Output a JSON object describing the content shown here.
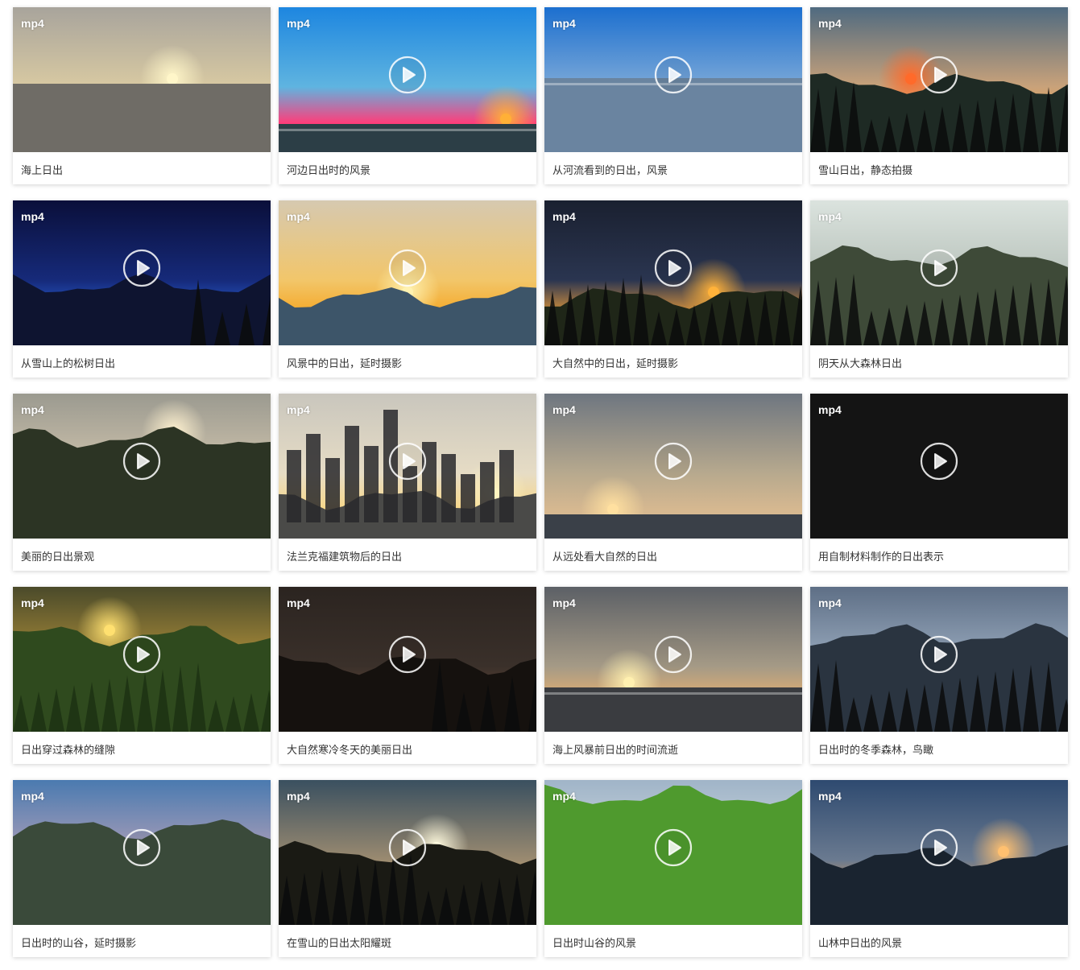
{
  "colors": {
    "card_bg": "#ffffff",
    "title_text": "#333333",
    "badge_text": "#ffffff"
  },
  "videos": [
    {
      "format": "mp4",
      "title": "海上日出",
      "scene": "sea-sunrise",
      "show_play": false,
      "sky": [
        "#a8a49c",
        "#d8c9a2",
        "#e8d6a4"
      ],
      "ground": "#6f6c66",
      "sun": "#fff6c9",
      "icon": "sun-icon"
    },
    {
      "format": "mp4",
      "title": "河边日出时的风景",
      "scene": "river-sunset",
      "show_play": true,
      "sky": [
        "#1d86e0",
        "#5fb4e0",
        "#ff3d7a"
      ],
      "ground": "#2c3e46",
      "sun": "#ffb037",
      "icon": "play-icon"
    },
    {
      "format": "mp4",
      "title": "从河流看到的日出，风景",
      "scene": "river-lake",
      "show_play": true,
      "sky": [
        "#1c6fcf",
        "#7aa8d8",
        "#ff5a8a"
      ],
      "ground": "#6a84a0",
      "sun": "#ffd6a0",
      "icon": "play-icon"
    },
    {
      "format": "mp4",
      "title": "雪山日出，静态拍摄",
      "scene": "snow-mountain",
      "show_play": true,
      "sky": [
        "#4f6a80",
        "#c9a27a",
        "#f2a64a"
      ],
      "ground": "#1e2a24",
      "sun": "#ff6a2a",
      "icon": "play-icon"
    },
    {
      "format": "mp4",
      "title": "从雪山上的松树日出",
      "scene": "pine-night",
      "show_play": true,
      "sky": [
        "#0a0f3a",
        "#162a7a",
        "#2a62d8"
      ],
      "ground": "#0e1430",
      "sun": "#2a62d8",
      "icon": "play-icon"
    },
    {
      "format": "mp4",
      "title": "风景中的日出，延时摄影",
      "scene": "landscape-timelapse",
      "show_play": true,
      "sky": [
        "#d6c9b0",
        "#f2c66a",
        "#f5a623"
      ],
      "ground": "#3d5569",
      "sun": "#fff2b0",
      "icon": "play-icon"
    },
    {
      "format": "mp4",
      "title": "大自然中的日出，延时摄影",
      "scene": "night-sunrise",
      "show_play": true,
      "sky": [
        "#1a2030",
        "#2a3550",
        "#e69a3a"
      ],
      "ground": "#1f2618",
      "sun": "#ffb23a",
      "icon": "play-icon"
    },
    {
      "format": "mp4",
      "title": "阴天从大森林日出",
      "scene": "cloudy-forest",
      "show_play": true,
      "sky": [
        "#dbe3de",
        "#b8c2bb",
        "#8a968c"
      ],
      "ground": "#3e4a38",
      "sun": "#ffffff",
      "icon": "play-icon"
    },
    {
      "format": "mp4",
      "title": "美丽的日出景观",
      "scene": "valley-misty",
      "show_play": true,
      "sky": [
        "#9b9a90",
        "#cfc3ac",
        "#e6d5b0"
      ],
      "ground": "#2c3424",
      "sun": "#fff2d0",
      "icon": "play-icon"
    },
    {
      "format": "mp4",
      "title": "法兰克福建筑物后的日出",
      "scene": "city-skyline",
      "show_play": true,
      "sky": [
        "#c9c6bd",
        "#e6dcc5",
        "#f8d889"
      ],
      "ground": "#4a4a48",
      "sun": "#fff5c0",
      "icon": "play-icon"
    },
    {
      "format": "mp4",
      "title": "从远处看大自然的日出",
      "scene": "distant-sea",
      "show_play": true,
      "sky": [
        "#6e7680",
        "#b7a98e",
        "#d6b890"
      ],
      "ground": "#3a4048",
      "sun": "#ffe0a0",
      "icon": "play-icon"
    },
    {
      "format": "mp4",
      "title": "用自制材料制作的日出表示",
      "scene": "black",
      "show_play": true,
      "sky": [
        "#141414",
        "#141414",
        "#141414"
      ],
      "ground": "#141414",
      "sun": "#141414",
      "icon": "play-icon"
    },
    {
      "format": "mp4",
      "title": "日出穿过森林的缝隙",
      "scene": "forest-light",
      "show_play": true,
      "sky": [
        "#4a4a2a",
        "#b0903a",
        "#f6d860"
      ],
      "ground": "#2f4a1e",
      "sun": "#ffe070",
      "icon": "play-icon"
    },
    {
      "format": "mp4",
      "title": "大自然寒冷冬天的美丽日出",
      "scene": "winter-night",
      "show_play": true,
      "sky": [
        "#2b2420",
        "#3a302a",
        "#6a4a3a"
      ],
      "ground": "#15110e",
      "sun": "#8a5a3a",
      "icon": "play-icon"
    },
    {
      "format": "mp4",
      "title": "海上风暴前日出的时间流逝",
      "scene": "storm-sea",
      "show_play": true,
      "sky": [
        "#5c6066",
        "#a59a86",
        "#e6b070"
      ],
      "ground": "#3a3c40",
      "sun": "#fff0b0",
      "icon": "play-icon"
    },
    {
      "format": "mp4",
      "title": "日出时的冬季森林，鸟瞰",
      "scene": "winter-aerial",
      "show_play": true,
      "sky": [
        "#5e6f86",
        "#9aabbf",
        "#d7dfe8"
      ],
      "ground": "#2a3440",
      "sun": "#ffffff",
      "icon": "play-icon"
    },
    {
      "format": "mp4",
      "title": "日出时的山谷，延时摄影",
      "scene": "valley-clouds",
      "show_play": true,
      "sky": [
        "#4a7ab0",
        "#b0a0b8",
        "#e0c090"
      ],
      "ground": "#3a4a3a",
      "sun": "#fff0c0",
      "icon": "play-icon"
    },
    {
      "format": "mp4",
      "title": "在雪山的日出太阳耀斑",
      "scene": "snow-flare",
      "show_play": true,
      "sky": [
        "#3a5060",
        "#9a8a70",
        "#f0c070"
      ],
      "ground": "#1a1a14",
      "sun": "#fffbe0",
      "icon": "play-icon"
    },
    {
      "format": "mp4",
      "title": "日出时山谷的风景",
      "scene": "green-valley",
      "show_play": true,
      "sky": [
        "#a0b4c8",
        "#d0dce0",
        "#e8efe0"
      ],
      "ground": "#4f9a2e",
      "sun": "#ffffff",
      "icon": "play-icon"
    },
    {
      "format": "mp4",
      "title": "山林中日出的风景",
      "scene": "mountain-dusk",
      "show_play": true,
      "sky": [
        "#2e4a70",
        "#6a7a90",
        "#e09a50"
      ],
      "ground": "#1a2430",
      "sun": "#ffc070",
      "icon": "play-icon"
    }
  ]
}
